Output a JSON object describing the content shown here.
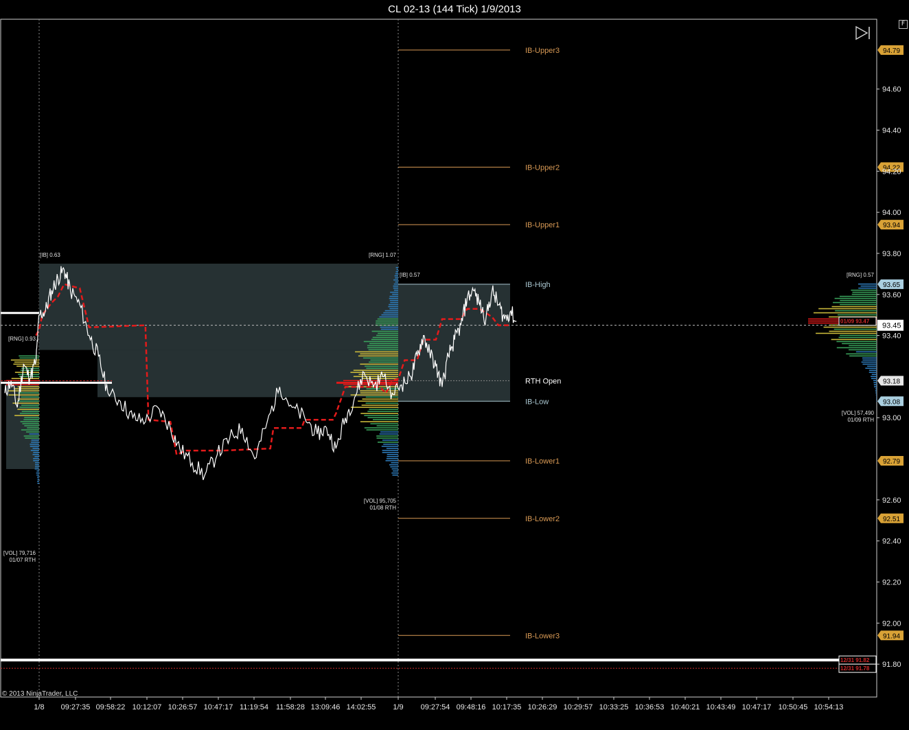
{
  "window": {
    "title": "CL 02-13 (144 Tick)  1/9/2013",
    "options_label": "F"
  },
  "footer": {
    "copyright": "© 2013 NinjaTrader, LLC"
  },
  "icons": {
    "go_to_end": "skip-to-end-icon"
  },
  "colors": {
    "background": "#000000",
    "price_line": "#ffffff",
    "vwap_dashed": "#e31b1b",
    "ib_shade": "#263133",
    "ib_extension": "#d99a55",
    "ib_range_line": "#aac7d1",
    "price_marker_orange": "#d9a236",
    "price_marker_blue": "#aacfe0",
    "last_price_marker": "#ffffff",
    "prior_marker_red": "#d12b2b",
    "profile_low": "#2d7ab8",
    "profile_mid": "#39a05a",
    "profile_high": "#c9b83a",
    "profile_poc": "#e01919"
  },
  "chart_data": {
    "type": "line",
    "instrument": "CL 02-13",
    "interval": "144 Tick",
    "date": "1/9/2013",
    "y_range": [
      91.64,
      94.94
    ],
    "y_ticks": [
      94.6,
      94.4,
      94.2,
      94.0,
      93.8,
      93.6,
      93.4,
      93.0,
      92.6,
      92.4,
      92.2,
      92.0,
      91.8
    ],
    "x_labels": [
      "1/8",
      "09:27:35",
      "09:58:22",
      "10:12:07",
      "10:26:57",
      "10:47:17",
      "11:19:54",
      "11:58:28",
      "13:09:46",
      "14:02:55",
      "1/9",
      "09:27:54",
      "09:48:16",
      "10:17:35",
      "10:26:29",
      "10:29:57",
      "10:33:25",
      "10:36:53",
      "10:40:21",
      "10:43:49",
      "10:47:17",
      "10:50:45",
      "10:54:13"
    ],
    "session_dividers": [
      "1/8",
      "1/9"
    ],
    "last_price": 93.45,
    "price_series": {
      "name": "",
      "points": [
        [
          0,
          93.12
        ],
        [
          0.2,
          93.18
        ],
        [
          0.4,
          93.05
        ],
        [
          0.6,
          93.26
        ],
        [
          0.8,
          93.19
        ],
        [
          1.0,
          93.28
        ],
        [
          1.1,
          93.5
        ],
        [
          1.3,
          93.52
        ],
        [
          1.5,
          93.62
        ],
        [
          1.7,
          93.68
        ],
        [
          1.9,
          93.72
        ],
        [
          2.1,
          93.62
        ],
        [
          2.4,
          93.55
        ],
        [
          2.7,
          93.4
        ],
        [
          3.0,
          93.3
        ],
        [
          3.3,
          93.12
        ],
        [
          3.7,
          93.08
        ],
        [
          4.1,
          93.0
        ],
        [
          4.5,
          92.98
        ],
        [
          4.9,
          93.05
        ],
        [
          5.3,
          92.95
        ],
        [
          5.6,
          92.85
        ],
        [
          6.0,
          92.78
        ],
        [
          6.4,
          92.72
        ],
        [
          6.8,
          92.82
        ],
        [
          7.2,
          92.9
        ],
        [
          7.6,
          92.95
        ],
        [
          8.0,
          92.8
        ],
        [
          8.4,
          92.98
        ],
        [
          8.8,
          93.15
        ],
        [
          9.2,
          93.05
        ],
        [
          9.6,
          93.0
        ],
        [
          10.0,
          92.92
        ],
        [
          10.3,
          92.95
        ],
        [
          10.6,
          92.85
        ],
        [
          10.9,
          93.0
        ],
        [
          11.2,
          93.1
        ],
        [
          11.5,
          93.22
        ],
        [
          11.8,
          93.15
        ],
        [
          12.1,
          93.2
        ],
        [
          12.4,
          93.12
        ],
        [
          12.7,
          93.16
        ],
        [
          13.0,
          93.2
        ],
        [
          13.2,
          93.3
        ],
        [
          13.4,
          93.4
        ],
        [
          13.6,
          93.32
        ],
        [
          13.8,
          93.25
        ],
        [
          14.0,
          93.15
        ],
        [
          14.2,
          93.3
        ],
        [
          14.4,
          93.38
        ],
        [
          14.6,
          93.45
        ],
        [
          14.8,
          93.58
        ],
        [
          15.0,
          93.62
        ],
        [
          15.2,
          93.55
        ],
        [
          15.4,
          93.48
        ],
        [
          15.6,
          93.62
        ],
        [
          15.8,
          93.55
        ],
        [
          16.0,
          93.48
        ],
        [
          16.2,
          93.52
        ],
        [
          16.4,
          93.45
        ]
      ]
    },
    "vwap_series": {
      "name": "",
      "points": [
        [
          1.0,
          93.4
        ],
        [
          1.1,
          93.43
        ],
        [
          1.2,
          93.5
        ],
        [
          1.5,
          93.56
        ],
        [
          1.7,
          93.59
        ],
        [
          1.9,
          93.65
        ],
        [
          2.4,
          93.63
        ],
        [
          2.7,
          93.44
        ],
        [
          4.5,
          93.45
        ],
        [
          4.6,
          92.99
        ],
        [
          5.3,
          92.98
        ],
        [
          5.5,
          92.82
        ],
        [
          5.8,
          92.84
        ],
        [
          6.2,
          92.84
        ],
        [
          7.0,
          92.84
        ],
        [
          8.5,
          92.85
        ],
        [
          8.6,
          92.95
        ],
        [
          9.5,
          92.95
        ],
        [
          9.6,
          92.99
        ],
        [
          10.5,
          92.99
        ],
        [
          10.6,
          93.02
        ],
        [
          10.9,
          93.15
        ],
        [
          12.0,
          93.15
        ],
        [
          12.2,
          93.12
        ],
        [
          12.4,
          93.18
        ],
        [
          12.6,
          93.19
        ],
        [
          12.8,
          93.28
        ],
        [
          13.2,
          93.28
        ],
        [
          13.4,
          93.38
        ],
        [
          13.8,
          93.38
        ],
        [
          14.0,
          93.48
        ],
        [
          14.6,
          93.48
        ],
        [
          14.8,
          93.53
        ],
        [
          15.2,
          93.53
        ],
        [
          15.3,
          93.52
        ],
        [
          15.6,
          93.49
        ],
        [
          15.8,
          93.45
        ],
        [
          16.2,
          93.45
        ]
      ]
    },
    "levels": [
      {
        "label": "IB-Upper3",
        "value": 94.79,
        "marker": "94.79"
      },
      {
        "label": "IB-Upper2",
        "value": 94.22,
        "marker": "94.22"
      },
      {
        "label": "IB-Upper1",
        "value": 93.94,
        "marker": "93.94"
      },
      {
        "label": "IB-High",
        "value": 93.65,
        "marker": "93.65"
      },
      {
        "label": "RTH Open",
        "value": 93.18,
        "marker": "93.18"
      },
      {
        "label": "IB-Low",
        "value": 93.08,
        "marker": "93.08"
      },
      {
        "label": "IB-Lower1",
        "value": 92.79,
        "marker": "92.79"
      },
      {
        "label": "IB-Lower2",
        "value": 92.51,
        "marker": "92.51"
      },
      {
        "label": "IB-Lower3",
        "value": 91.94,
        "marker": "91.94"
      }
    ],
    "prior_levels": [
      {
        "label": "12/31 91.82",
        "value": 91.82
      },
      {
        "label": "12/31 91.78",
        "value": 91.78
      }
    ],
    "last_price_marker": {
      "label": "01/09 93.47",
      "value": 93.47
    },
    "annotations": [
      {
        "text": "[IB] 0.63"
      },
      {
        "text": "[RNG] 1.07"
      },
      {
        "text": "[RNG] 0.93"
      },
      {
        "text": "[IB] 0.57"
      },
      {
        "text": "[RNG] 0.57"
      },
      {
        "text": "[VOL] 95,705",
        "sub": "01/08 RTH"
      },
      {
        "text": "[VOL] 79,716",
        "sub": "01/07 RTH"
      },
      {
        "text": "[VOL] 57,490",
        "sub": "01/09 RTH"
      }
    ],
    "sessions": [
      {
        "name": "01/07 RTH",
        "ib_range": [
          93.33,
          93.75
        ]
      },
      {
        "name": "01/08 RTH",
        "ib_range": [
          93.1,
          93.75
        ]
      },
      {
        "name": "01/09 RTH",
        "ib_range": [
          93.08,
          93.65
        ]
      }
    ],
    "grid": false,
    "legend": "none"
  }
}
